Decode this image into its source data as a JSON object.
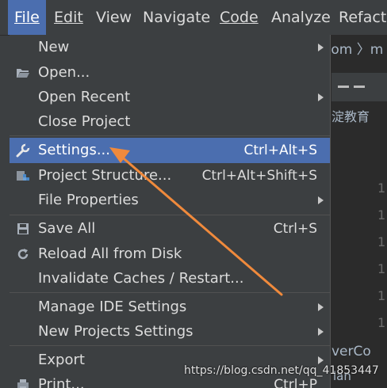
{
  "menubar": {
    "items": [
      "File",
      "Edit",
      "View",
      "Navigate",
      "Code",
      "Analyze",
      "Refactor"
    ]
  },
  "background": {
    "breadcrumb": "com 〉m",
    "editor_text": "淀教育",
    "line_numbers": [
      "1",
      "1",
      "1",
      "1",
      "1",
      "1"
    ],
    "code_fragment": "verCo",
    "code_fragment2": "lan"
  },
  "file_menu": {
    "items": [
      {
        "label": "New",
        "shortcut": "",
        "submenu": true,
        "icon": ""
      },
      {
        "label": "Open...",
        "shortcut": "",
        "submenu": false,
        "icon": "folder-open-icon"
      },
      {
        "label": "Open Recent",
        "shortcut": "",
        "submenu": true,
        "icon": ""
      },
      {
        "label": "Close Project",
        "shortcut": "",
        "submenu": false,
        "icon": ""
      },
      {
        "label": "Settings...",
        "shortcut": "Ctrl+Alt+S",
        "submenu": false,
        "icon": "wrench-icon",
        "selected": true
      },
      {
        "label": "Project Structure...",
        "shortcut": "Ctrl+Alt+Shift+S",
        "submenu": false,
        "icon": "project-structure-icon"
      },
      {
        "label": "File Properties",
        "shortcut": "",
        "submenu": true,
        "icon": ""
      },
      {
        "label": "Save All",
        "shortcut": "Ctrl+S",
        "submenu": false,
        "icon": "save-icon"
      },
      {
        "label": "Reload All from Disk",
        "shortcut": "",
        "submenu": false,
        "icon": "reload-icon"
      },
      {
        "label": "Invalidate Caches / Restart...",
        "shortcut": "",
        "submenu": false,
        "icon": ""
      },
      {
        "label": "Manage IDE Settings",
        "shortcut": "",
        "submenu": true,
        "icon": ""
      },
      {
        "label": "New Projects Settings",
        "shortcut": "",
        "submenu": true,
        "icon": ""
      },
      {
        "label": "Export",
        "shortcut": "",
        "submenu": true,
        "icon": ""
      },
      {
        "label": "Print...",
        "shortcut": "Ctrl+P",
        "submenu": false,
        "icon": "print-icon"
      }
    ]
  },
  "watermark": "https://blog.csdn.net/qq_41853447",
  "colors": {
    "menu_bg": "#3c3f41",
    "selection": "#4b6eaf",
    "annotation_arrow": "#f08a3c"
  }
}
